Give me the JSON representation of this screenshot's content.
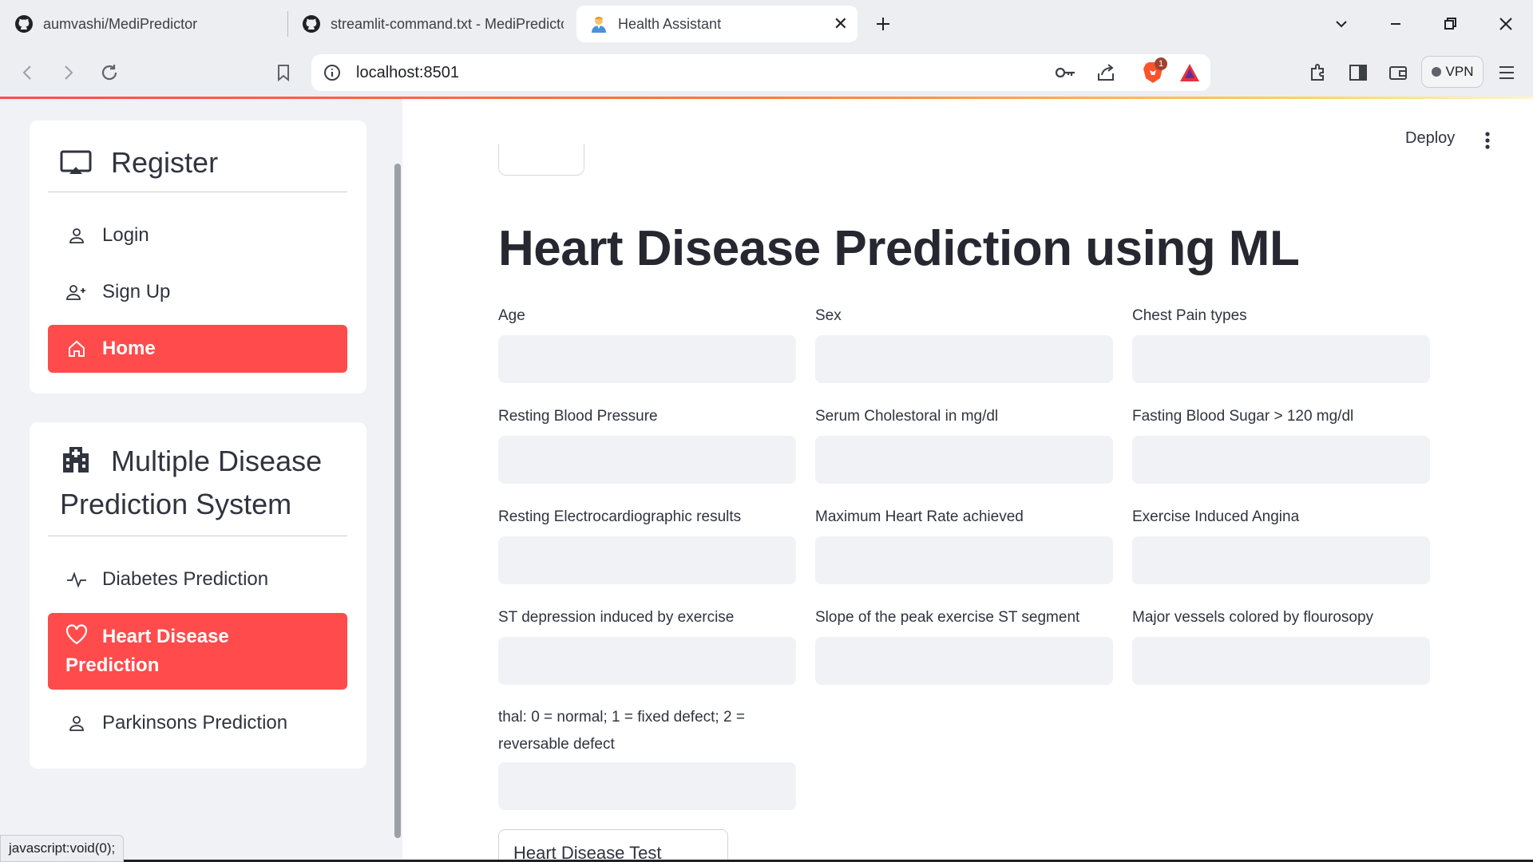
{
  "browser": {
    "tabs": [
      {
        "title": "aumvashi/MediPredictor",
        "icon": "github-icon"
      },
      {
        "title": "streamlit-command.txt - MediPredictor",
        "icon": "github-icon"
      },
      {
        "title": "Health Assistant",
        "icon": "doctor-emoji-icon"
      }
    ],
    "url": "localhost:8501",
    "vpn_label": "VPN",
    "brave_badge": "1"
  },
  "sidebar": {
    "account_menu": {
      "title": "Register",
      "icon": "cast-icon",
      "items": [
        {
          "label": "Login",
          "icon": "person-icon",
          "active": false
        },
        {
          "label": "Sign Up",
          "icon": "person-add-icon",
          "active": false
        },
        {
          "label": "Home",
          "icon": "house-icon",
          "active": true
        }
      ]
    },
    "app_menu": {
      "title_line1": "Multiple Disease",
      "title_line2": "Prediction System",
      "icon": "hospital-icon",
      "items": [
        {
          "label": "Diabetes Prediction",
          "icon": "activity-icon",
          "active": false
        },
        {
          "label_line1": "Heart Disease",
          "label_line2": "Prediction",
          "icon": "heart-icon",
          "active": true
        },
        {
          "label": "Parkinsons Prediction",
          "icon": "person-icon",
          "active": false
        }
      ]
    }
  },
  "header": {
    "deploy_label": "Deploy"
  },
  "main": {
    "title": "Heart Disease Prediction using ML",
    "fields": [
      {
        "label": "Age",
        "value": ""
      },
      {
        "label": "Sex",
        "value": ""
      },
      {
        "label": "Chest Pain types",
        "value": ""
      },
      {
        "label": "Resting Blood Pressure",
        "value": ""
      },
      {
        "label": "Serum Cholestoral in mg/dl",
        "value": ""
      },
      {
        "label": "Fasting Blood Sugar > 120 mg/dl",
        "value": ""
      },
      {
        "label": "Resting Electrocardiographic results",
        "value": ""
      },
      {
        "label": "Maximum Heart Rate achieved",
        "value": ""
      },
      {
        "label": "Exercise Induced Angina",
        "value": ""
      },
      {
        "label": "ST depression induced by exercise",
        "value": ""
      },
      {
        "label": "Slope of the peak exercise ST segment",
        "value": ""
      },
      {
        "label": "Major vessels colored by flourosopy",
        "value": ""
      },
      {
        "label_line1": "thal: 0 = normal; 1 = fixed defect; 2 =",
        "label_line2": "reversable defect",
        "value": ""
      }
    ],
    "submit_label": "Heart Disease Test Result"
  },
  "status_bar": "javascript:void(0);",
  "colors": {
    "accent": "#ff4b4b",
    "sidebar_bg": "#f0f2f6",
    "input_bg": "#f0f2f6",
    "text": "#31333f"
  }
}
